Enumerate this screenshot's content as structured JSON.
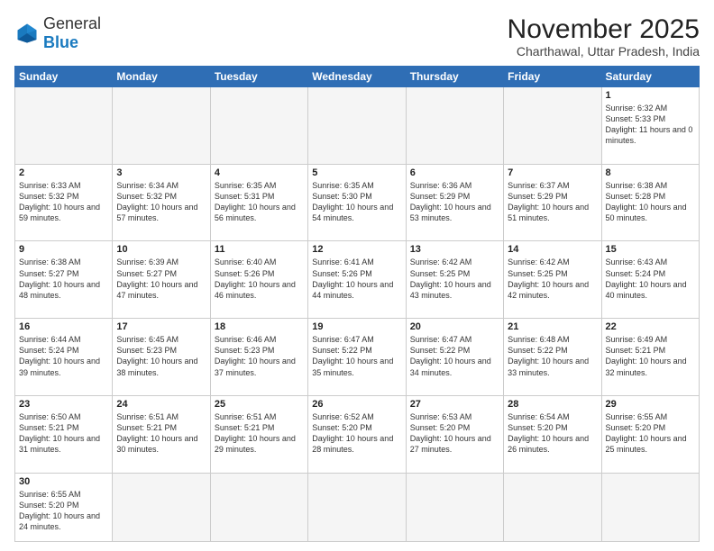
{
  "header": {
    "logo_general": "General",
    "logo_blue": "Blue",
    "month_year": "November 2025",
    "location": "Charthawal, Uttar Pradesh, India"
  },
  "weekdays": [
    "Sunday",
    "Monday",
    "Tuesday",
    "Wednesday",
    "Thursday",
    "Friday",
    "Saturday"
  ],
  "weeks": [
    [
      {
        "day": "",
        "info": ""
      },
      {
        "day": "",
        "info": ""
      },
      {
        "day": "",
        "info": ""
      },
      {
        "day": "",
        "info": ""
      },
      {
        "day": "",
        "info": ""
      },
      {
        "day": "",
        "info": ""
      },
      {
        "day": "1",
        "info": "Sunrise: 6:32 AM\nSunset: 5:33 PM\nDaylight: 11 hours and 0 minutes."
      }
    ],
    [
      {
        "day": "2",
        "info": "Sunrise: 6:33 AM\nSunset: 5:32 PM\nDaylight: 10 hours and 59 minutes."
      },
      {
        "day": "3",
        "info": "Sunrise: 6:34 AM\nSunset: 5:32 PM\nDaylight: 10 hours and 57 minutes."
      },
      {
        "day": "4",
        "info": "Sunrise: 6:35 AM\nSunset: 5:31 PM\nDaylight: 10 hours and 56 minutes."
      },
      {
        "day": "5",
        "info": "Sunrise: 6:35 AM\nSunset: 5:30 PM\nDaylight: 10 hours and 54 minutes."
      },
      {
        "day": "6",
        "info": "Sunrise: 6:36 AM\nSunset: 5:29 PM\nDaylight: 10 hours and 53 minutes."
      },
      {
        "day": "7",
        "info": "Sunrise: 6:37 AM\nSunset: 5:29 PM\nDaylight: 10 hours and 51 minutes."
      },
      {
        "day": "8",
        "info": "Sunrise: 6:38 AM\nSunset: 5:28 PM\nDaylight: 10 hours and 50 minutes."
      }
    ],
    [
      {
        "day": "9",
        "info": "Sunrise: 6:38 AM\nSunset: 5:27 PM\nDaylight: 10 hours and 48 minutes."
      },
      {
        "day": "10",
        "info": "Sunrise: 6:39 AM\nSunset: 5:27 PM\nDaylight: 10 hours and 47 minutes."
      },
      {
        "day": "11",
        "info": "Sunrise: 6:40 AM\nSunset: 5:26 PM\nDaylight: 10 hours and 46 minutes."
      },
      {
        "day": "12",
        "info": "Sunrise: 6:41 AM\nSunset: 5:26 PM\nDaylight: 10 hours and 44 minutes."
      },
      {
        "day": "13",
        "info": "Sunrise: 6:42 AM\nSunset: 5:25 PM\nDaylight: 10 hours and 43 minutes."
      },
      {
        "day": "14",
        "info": "Sunrise: 6:42 AM\nSunset: 5:25 PM\nDaylight: 10 hours and 42 minutes."
      },
      {
        "day": "15",
        "info": "Sunrise: 6:43 AM\nSunset: 5:24 PM\nDaylight: 10 hours and 40 minutes."
      }
    ],
    [
      {
        "day": "16",
        "info": "Sunrise: 6:44 AM\nSunset: 5:24 PM\nDaylight: 10 hours and 39 minutes."
      },
      {
        "day": "17",
        "info": "Sunrise: 6:45 AM\nSunset: 5:23 PM\nDaylight: 10 hours and 38 minutes."
      },
      {
        "day": "18",
        "info": "Sunrise: 6:46 AM\nSunset: 5:23 PM\nDaylight: 10 hours and 37 minutes."
      },
      {
        "day": "19",
        "info": "Sunrise: 6:47 AM\nSunset: 5:22 PM\nDaylight: 10 hours and 35 minutes."
      },
      {
        "day": "20",
        "info": "Sunrise: 6:47 AM\nSunset: 5:22 PM\nDaylight: 10 hours and 34 minutes."
      },
      {
        "day": "21",
        "info": "Sunrise: 6:48 AM\nSunset: 5:22 PM\nDaylight: 10 hours and 33 minutes."
      },
      {
        "day": "22",
        "info": "Sunrise: 6:49 AM\nSunset: 5:21 PM\nDaylight: 10 hours and 32 minutes."
      }
    ],
    [
      {
        "day": "23",
        "info": "Sunrise: 6:50 AM\nSunset: 5:21 PM\nDaylight: 10 hours and 31 minutes."
      },
      {
        "day": "24",
        "info": "Sunrise: 6:51 AM\nSunset: 5:21 PM\nDaylight: 10 hours and 30 minutes."
      },
      {
        "day": "25",
        "info": "Sunrise: 6:51 AM\nSunset: 5:21 PM\nDaylight: 10 hours and 29 minutes."
      },
      {
        "day": "26",
        "info": "Sunrise: 6:52 AM\nSunset: 5:20 PM\nDaylight: 10 hours and 28 minutes."
      },
      {
        "day": "27",
        "info": "Sunrise: 6:53 AM\nSunset: 5:20 PM\nDaylight: 10 hours and 27 minutes."
      },
      {
        "day": "28",
        "info": "Sunrise: 6:54 AM\nSunset: 5:20 PM\nDaylight: 10 hours and 26 minutes."
      },
      {
        "day": "29",
        "info": "Sunrise: 6:55 AM\nSunset: 5:20 PM\nDaylight: 10 hours and 25 minutes."
      }
    ],
    [
      {
        "day": "30",
        "info": "Sunrise: 6:55 AM\nSunset: 5:20 PM\nDaylight: 10 hours and 24 minutes."
      },
      {
        "day": "",
        "info": ""
      },
      {
        "day": "",
        "info": ""
      },
      {
        "day": "",
        "info": ""
      },
      {
        "day": "",
        "info": ""
      },
      {
        "day": "",
        "info": ""
      },
      {
        "day": "",
        "info": ""
      }
    ]
  ]
}
